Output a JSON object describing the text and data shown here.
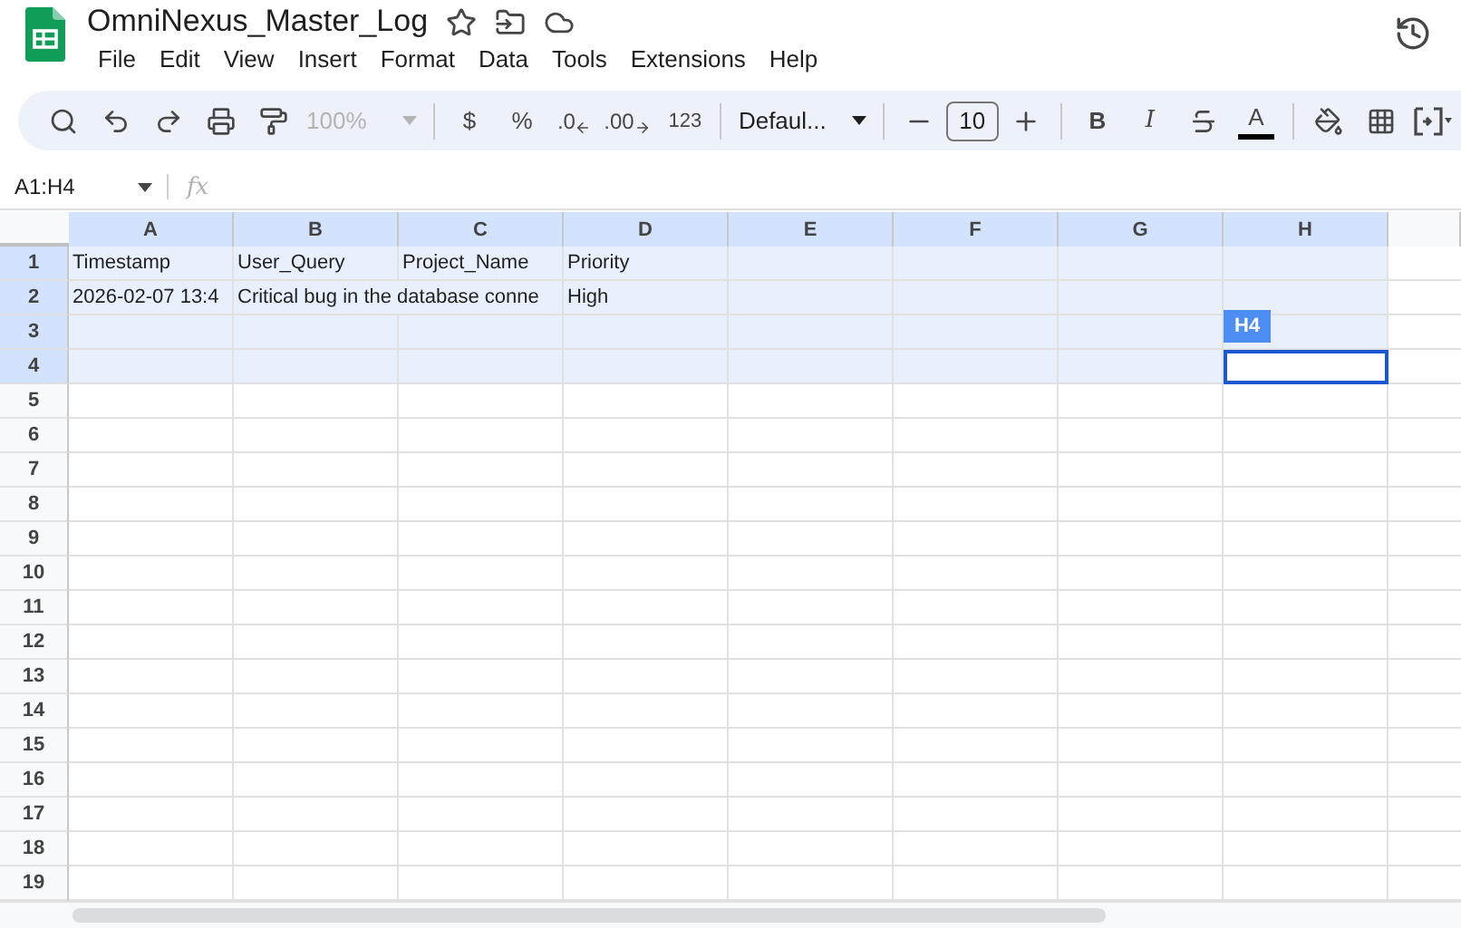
{
  "document": {
    "title": "OmniNexus_Master_Log",
    "starred": false
  },
  "menu": [
    "File",
    "Edit",
    "View",
    "Insert",
    "Format",
    "Data",
    "Tools",
    "Extensions",
    "Help"
  ],
  "toolbar": {
    "zoom": {
      "value": "100%",
      "disabled": true
    },
    "currency": "$",
    "percent": "%",
    "decrease_decimals": ".0",
    "increase_decimals": ".00",
    "number_format": "123",
    "font": "Defaul...",
    "font_size": "10",
    "bold": "B",
    "italic": "I",
    "text_color": "A"
  },
  "formula_bar": {
    "name_box": "A1:H4",
    "function_label": "fx"
  },
  "columns": [
    {
      "label": "A",
      "selected": true
    },
    {
      "label": "B",
      "selected": true
    },
    {
      "label": "C",
      "selected": true
    },
    {
      "label": "D",
      "selected": true
    },
    {
      "label": "E",
      "selected": true
    },
    {
      "label": "F",
      "selected": true
    },
    {
      "label": "G",
      "selected": true
    },
    {
      "label": "H",
      "selected": true
    }
  ],
  "rows": [
    {
      "number": "1",
      "selected": true,
      "cells": [
        {
          "text": "Timestamp"
        },
        {
          "text": "User_Query"
        },
        {
          "text": "Project_Name"
        },
        {
          "text": "Priority"
        }
      ]
    },
    {
      "number": "2",
      "selected": true,
      "cells": [
        {
          "text": "2026-02-07 13:4"
        },
        {
          "text": "Critical bug in the database conne",
          "overflows": true
        },
        {
          "text": "High"
        }
      ]
    },
    {
      "number": "3",
      "selected": true
    },
    {
      "number": "4",
      "selected": true,
      "cells": [
        {},
        {},
        {},
        {},
        {},
        {},
        {},
        {
          "active": true,
          "tag": "H4"
        }
      ]
    },
    {
      "number": "5",
      "selected": false
    },
    {
      "number": "6",
      "selected": false
    },
    {
      "number": "7",
      "selected": false
    },
    {
      "number": "8",
      "selected": false
    },
    {
      "number": "9",
      "selected": false
    },
    {
      "number": "10",
      "selected": false
    },
    {
      "number": "11",
      "selected": false
    },
    {
      "number": "12",
      "selected": false
    },
    {
      "number": "13",
      "selected": false
    },
    {
      "number": "14",
      "selected": false
    },
    {
      "number": "15",
      "selected": false
    },
    {
      "number": "16",
      "selected": false
    },
    {
      "number": "17",
      "selected": false
    },
    {
      "number": "18",
      "selected": false
    },
    {
      "number": "19",
      "selected": false
    }
  ]
}
